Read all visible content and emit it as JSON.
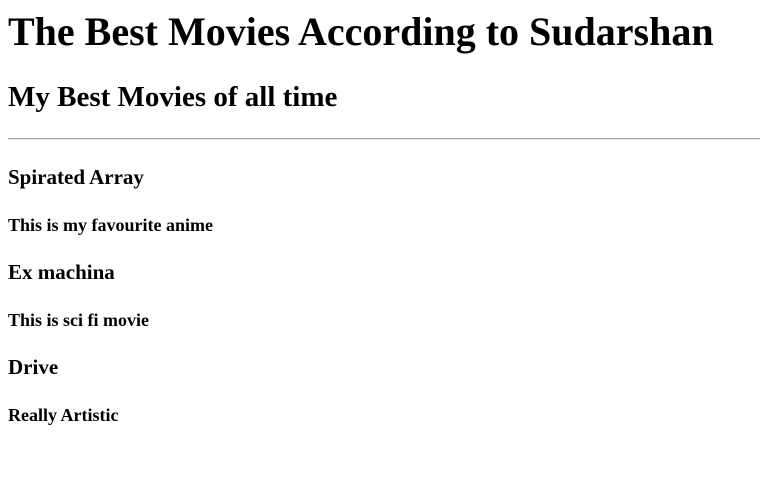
{
  "header": {
    "title": "The Best Movies According to Sudarshan",
    "subtitle": "My Best Movies of all time"
  },
  "movies": [
    {
      "name": "Spirated Array",
      "description": "This is my favourite anime"
    },
    {
      "name": "Ex machina",
      "description": "This is sci fi movie"
    },
    {
      "name": "Drive",
      "description": "Really Artistic"
    }
  ]
}
